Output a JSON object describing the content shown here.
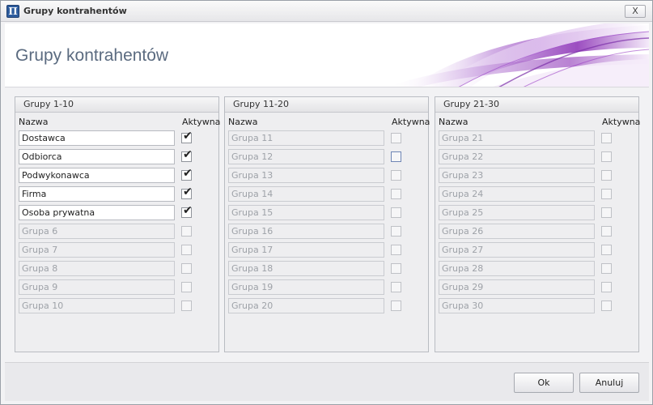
{
  "window": {
    "title": "Grupy kontrahentów",
    "close_label": "X",
    "icon_char": "Π"
  },
  "header": {
    "title": "Grupy kontrahentów"
  },
  "panels": [
    {
      "title": "Grupy 1-10",
      "col_name": "Nazwa",
      "col_active": "Aktywna",
      "rows": [
        {
          "name": "Dostawca",
          "enabled": true,
          "active": true
        },
        {
          "name": "Odbiorca",
          "enabled": true,
          "active": true
        },
        {
          "name": "Podwykonawca",
          "enabled": true,
          "active": true
        },
        {
          "name": "Firma",
          "enabled": true,
          "active": true
        },
        {
          "name": "Osoba prywatna",
          "enabled": true,
          "active": true
        },
        {
          "name": "Grupa 6",
          "enabled": false,
          "active": false
        },
        {
          "name": "Grupa 7",
          "enabled": false,
          "active": false
        },
        {
          "name": "Grupa 8",
          "enabled": false,
          "active": false
        },
        {
          "name": "Grupa 9",
          "enabled": false,
          "active": false
        },
        {
          "name": "Grupa 10",
          "enabled": false,
          "active": false
        }
      ]
    },
    {
      "title": "Grupy 11-20",
      "col_name": "Nazwa",
      "col_active": "Aktywna",
      "rows": [
        {
          "name": "Grupa 11",
          "enabled": false,
          "active": false
        },
        {
          "name": "Grupa 12",
          "enabled": false,
          "active": false,
          "focused": true
        },
        {
          "name": "Grupa 13",
          "enabled": false,
          "active": false
        },
        {
          "name": "Grupa 14",
          "enabled": false,
          "active": false
        },
        {
          "name": "Grupa 15",
          "enabled": false,
          "active": false
        },
        {
          "name": "Grupa 16",
          "enabled": false,
          "active": false
        },
        {
          "name": "Grupa 17",
          "enabled": false,
          "active": false
        },
        {
          "name": "Grupa 18",
          "enabled": false,
          "active": false
        },
        {
          "name": "Grupa 19",
          "enabled": false,
          "active": false
        },
        {
          "name": "Grupa 20",
          "enabled": false,
          "active": false
        }
      ]
    },
    {
      "title": "Grupy 21-30",
      "col_name": "Nazwa",
      "col_active": "Aktywna",
      "rows": [
        {
          "name": "Grupa 21",
          "enabled": false,
          "active": false
        },
        {
          "name": "Grupa 22",
          "enabled": false,
          "active": false
        },
        {
          "name": "Grupa 23",
          "enabled": false,
          "active": false
        },
        {
          "name": "Grupa 24",
          "enabled": false,
          "active": false
        },
        {
          "name": "Grupa 25",
          "enabled": false,
          "active": false
        },
        {
          "name": "Grupa 26",
          "enabled": false,
          "active": false
        },
        {
          "name": "Grupa 27",
          "enabled": false,
          "active": false
        },
        {
          "name": "Grupa 28",
          "enabled": false,
          "active": false
        },
        {
          "name": "Grupa 29",
          "enabled": false,
          "active": false
        },
        {
          "name": "Grupa 30",
          "enabled": false,
          "active": false
        }
      ]
    }
  ],
  "footer": {
    "ok_label": "Ok",
    "cancel_label": "Anuluj"
  }
}
